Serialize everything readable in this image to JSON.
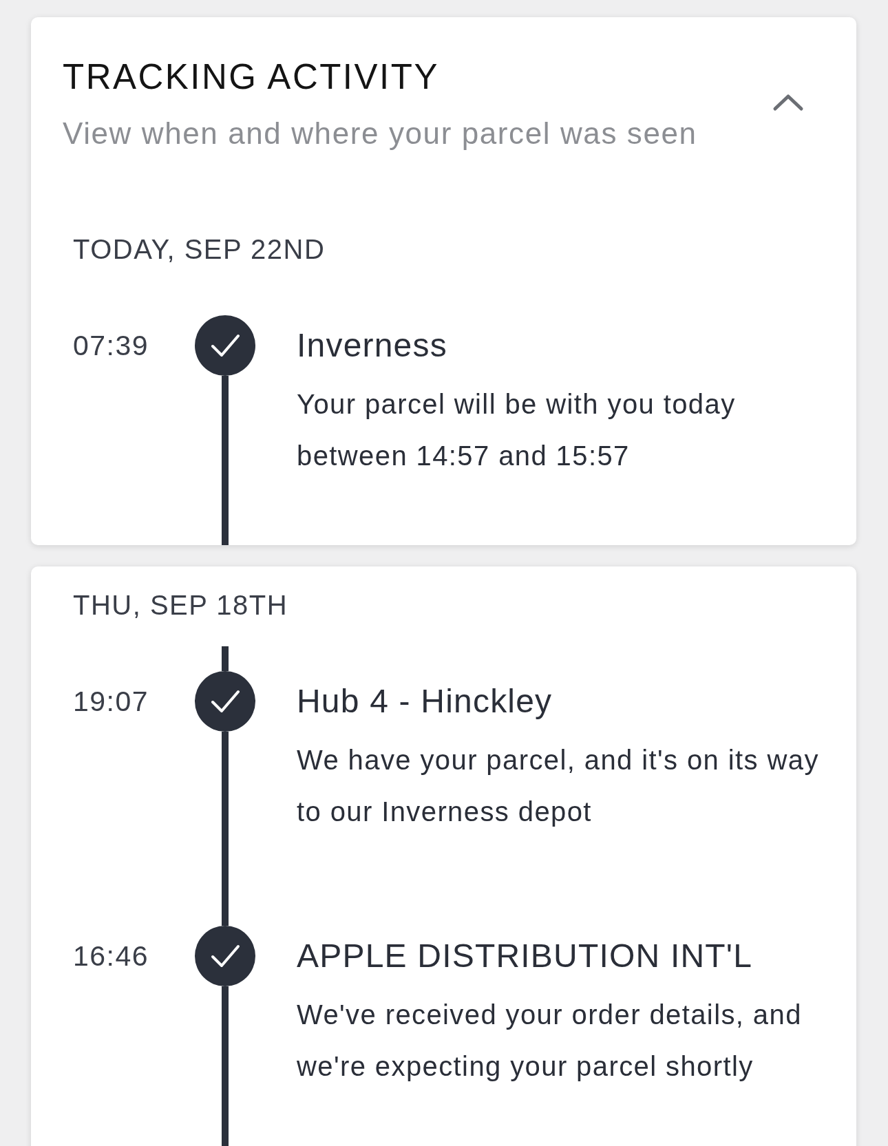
{
  "header": {
    "title": "TRACKING ACTIVITY",
    "subtitle": "View when and where your parcel was seen",
    "expanded": true
  },
  "groups": [
    {
      "date": "TODAY, SEP 22ND",
      "continued": false,
      "events": [
        {
          "time": "07:39",
          "title": "Inverness",
          "description": "Your parcel will be with you today between 14:57 and 15:57"
        }
      ]
    },
    {
      "date": "THU, SEP 18TH",
      "continued": true,
      "events": [
        {
          "time": "19:07",
          "title": "Hub 4 - Hinckley",
          "description": "We have your parcel, and it's on its way to our Inverness depot"
        },
        {
          "time": "16:46",
          "title": "APPLE DISTRIBUTION INT'L",
          "description": "We've received your order details, and we're expecting your parcel shortly"
        }
      ]
    }
  ]
}
